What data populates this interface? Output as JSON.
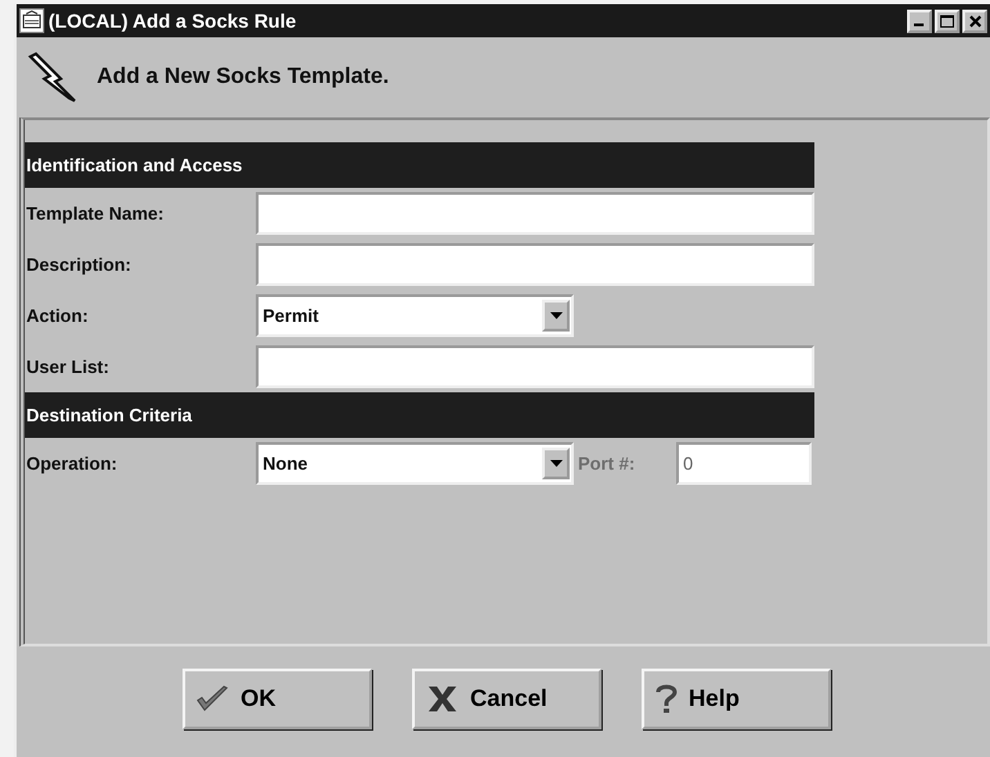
{
  "window": {
    "title": "(LOCAL) Add a Socks Rule"
  },
  "header": {
    "title": "Add a New Socks Template."
  },
  "sections": [
    {
      "title": "Identification and Access",
      "fields": [
        {
          "label": "Template Name:",
          "kind": "text"
        },
        {
          "label": "Description:",
          "kind": "text"
        },
        {
          "label": "Action:",
          "kind": "select",
          "value": "Permit"
        },
        {
          "label": "User List:",
          "kind": "text"
        }
      ]
    },
    {
      "title": "Destination Criteria",
      "fields": [
        {
          "label": "Operation:",
          "kind": "select",
          "value": "None",
          "extra": {
            "label": "Port #:",
            "value": "0",
            "disabled": true
          }
        }
      ]
    }
  ],
  "buttons": [
    {
      "label": "OK",
      "kind": "ok"
    },
    {
      "label": "Cancel",
      "kind": "cancel"
    },
    {
      "label": "Help",
      "kind": "help"
    }
  ]
}
